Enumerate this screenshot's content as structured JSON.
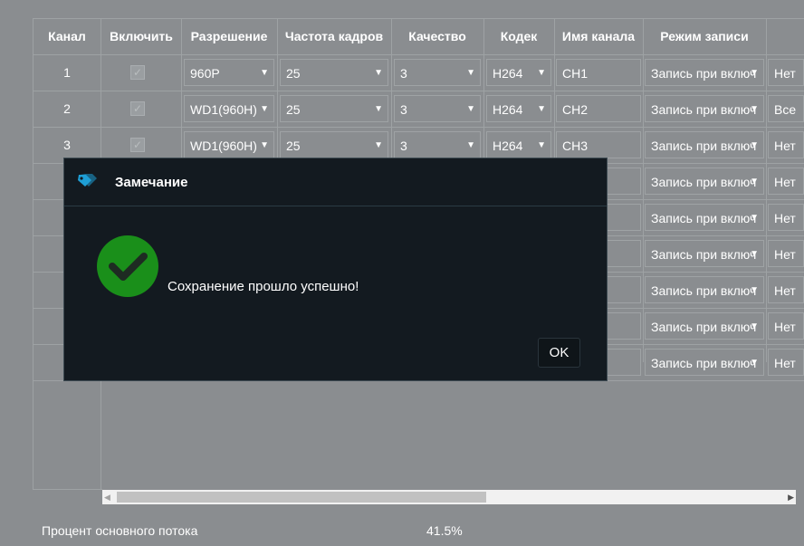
{
  "columns": [
    "Канал",
    "Включить",
    "Разрешение",
    "Частота кадров",
    "Качество",
    "Кодек",
    "Имя канала",
    "Режим записи"
  ],
  "rows": [
    {
      "channel": "1",
      "enabled": true,
      "resolution": "960P",
      "fps": "25",
      "quality": "3",
      "codec": "H264",
      "name": "CH1",
      "record_mode": "Запись при включ",
      "extra": "Нет"
    },
    {
      "channel": "2",
      "enabled": true,
      "resolution": "WD1(960H)",
      "fps": "25",
      "quality": "3",
      "codec": "H264",
      "name": "CH2",
      "record_mode": "Запись при включ",
      "extra": "Все"
    },
    {
      "channel": "3",
      "enabled": true,
      "resolution": "WD1(960H)",
      "fps": "25",
      "quality": "3",
      "codec": "H264",
      "name": "CH3",
      "record_mode": "Запись при включ",
      "extra": "Нет"
    },
    {
      "record_mode": "Запись при включ",
      "extra": "Нет"
    },
    {
      "record_mode": "Запись при включ",
      "extra": "Нет"
    },
    {
      "record_mode": "Запись при включ",
      "extra": "Нет"
    },
    {
      "record_mode": "Запись при включ",
      "extra": "Нет"
    },
    {
      "record_mode": "Запись при включ",
      "extra": "Нет"
    },
    {
      "record_mode": "Запись при включ",
      "extra": "Нет"
    }
  ],
  "dialog": {
    "title": "Замечание",
    "message": "Сохранение прошло успешно!",
    "ok_label": "OK",
    "header_icon": "tags-icon",
    "status_icon": "success-check-icon",
    "status_color": "#1a8f1a"
  },
  "footer": {
    "label": "Процент основного потока",
    "value": "41.5%"
  },
  "colors": {
    "overlay_bg": "#8a8d90",
    "dialog_bg": "#131a20",
    "header_icon": "#1e9fd6"
  }
}
